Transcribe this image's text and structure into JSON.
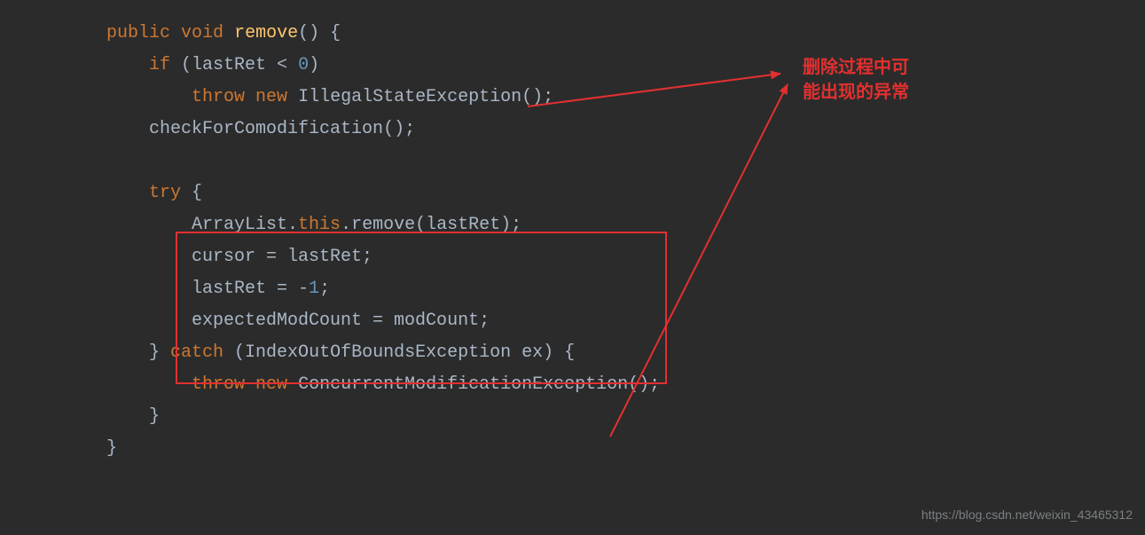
{
  "code": {
    "l1": {
      "kw1": "public",
      "kw2": "void",
      "fn": "remove",
      "p1": "() {"
    },
    "l2": {
      "kw": "if",
      "p1": " (",
      "id": "lastRet",
      "op": " < ",
      "num": "0",
      "p2": ")"
    },
    "l3": {
      "kw1": "throw",
      "kw2": "new",
      "cls": "IllegalStateException",
      "p": "();"
    },
    "l4": {
      "fn": "checkForComodification",
      "p": "();"
    },
    "l5": {
      "kw": "try",
      "p": " {"
    },
    "l6": {
      "a": "ArrayList.",
      "kw": "this",
      "b": ".",
      "fn": "remove",
      "c": "(",
      "id": "lastRet",
      "d": ");"
    },
    "l7": {
      "a": "cursor = lastRet;"
    },
    "l8": {
      "a": "lastRet = -",
      "num": "1",
      "b": ";"
    },
    "l9": {
      "a": "expectedModCount = modCount;"
    },
    "l10": {
      "a": "} ",
      "kw": "catch",
      "b": " (IndexOutOfBoundsException ex) {"
    },
    "l11": {
      "kw1": "throw",
      "kw2": "new",
      "cls": "ConcurrentModificationException",
      "p": "();"
    },
    "l12": {
      "a": "}"
    },
    "l13": {
      "a": "}"
    }
  },
  "annotation": {
    "line1": "删除过程中可",
    "line2": "能出现的异常"
  },
  "watermark": "https://blog.csdn.net/weixin_43465312"
}
